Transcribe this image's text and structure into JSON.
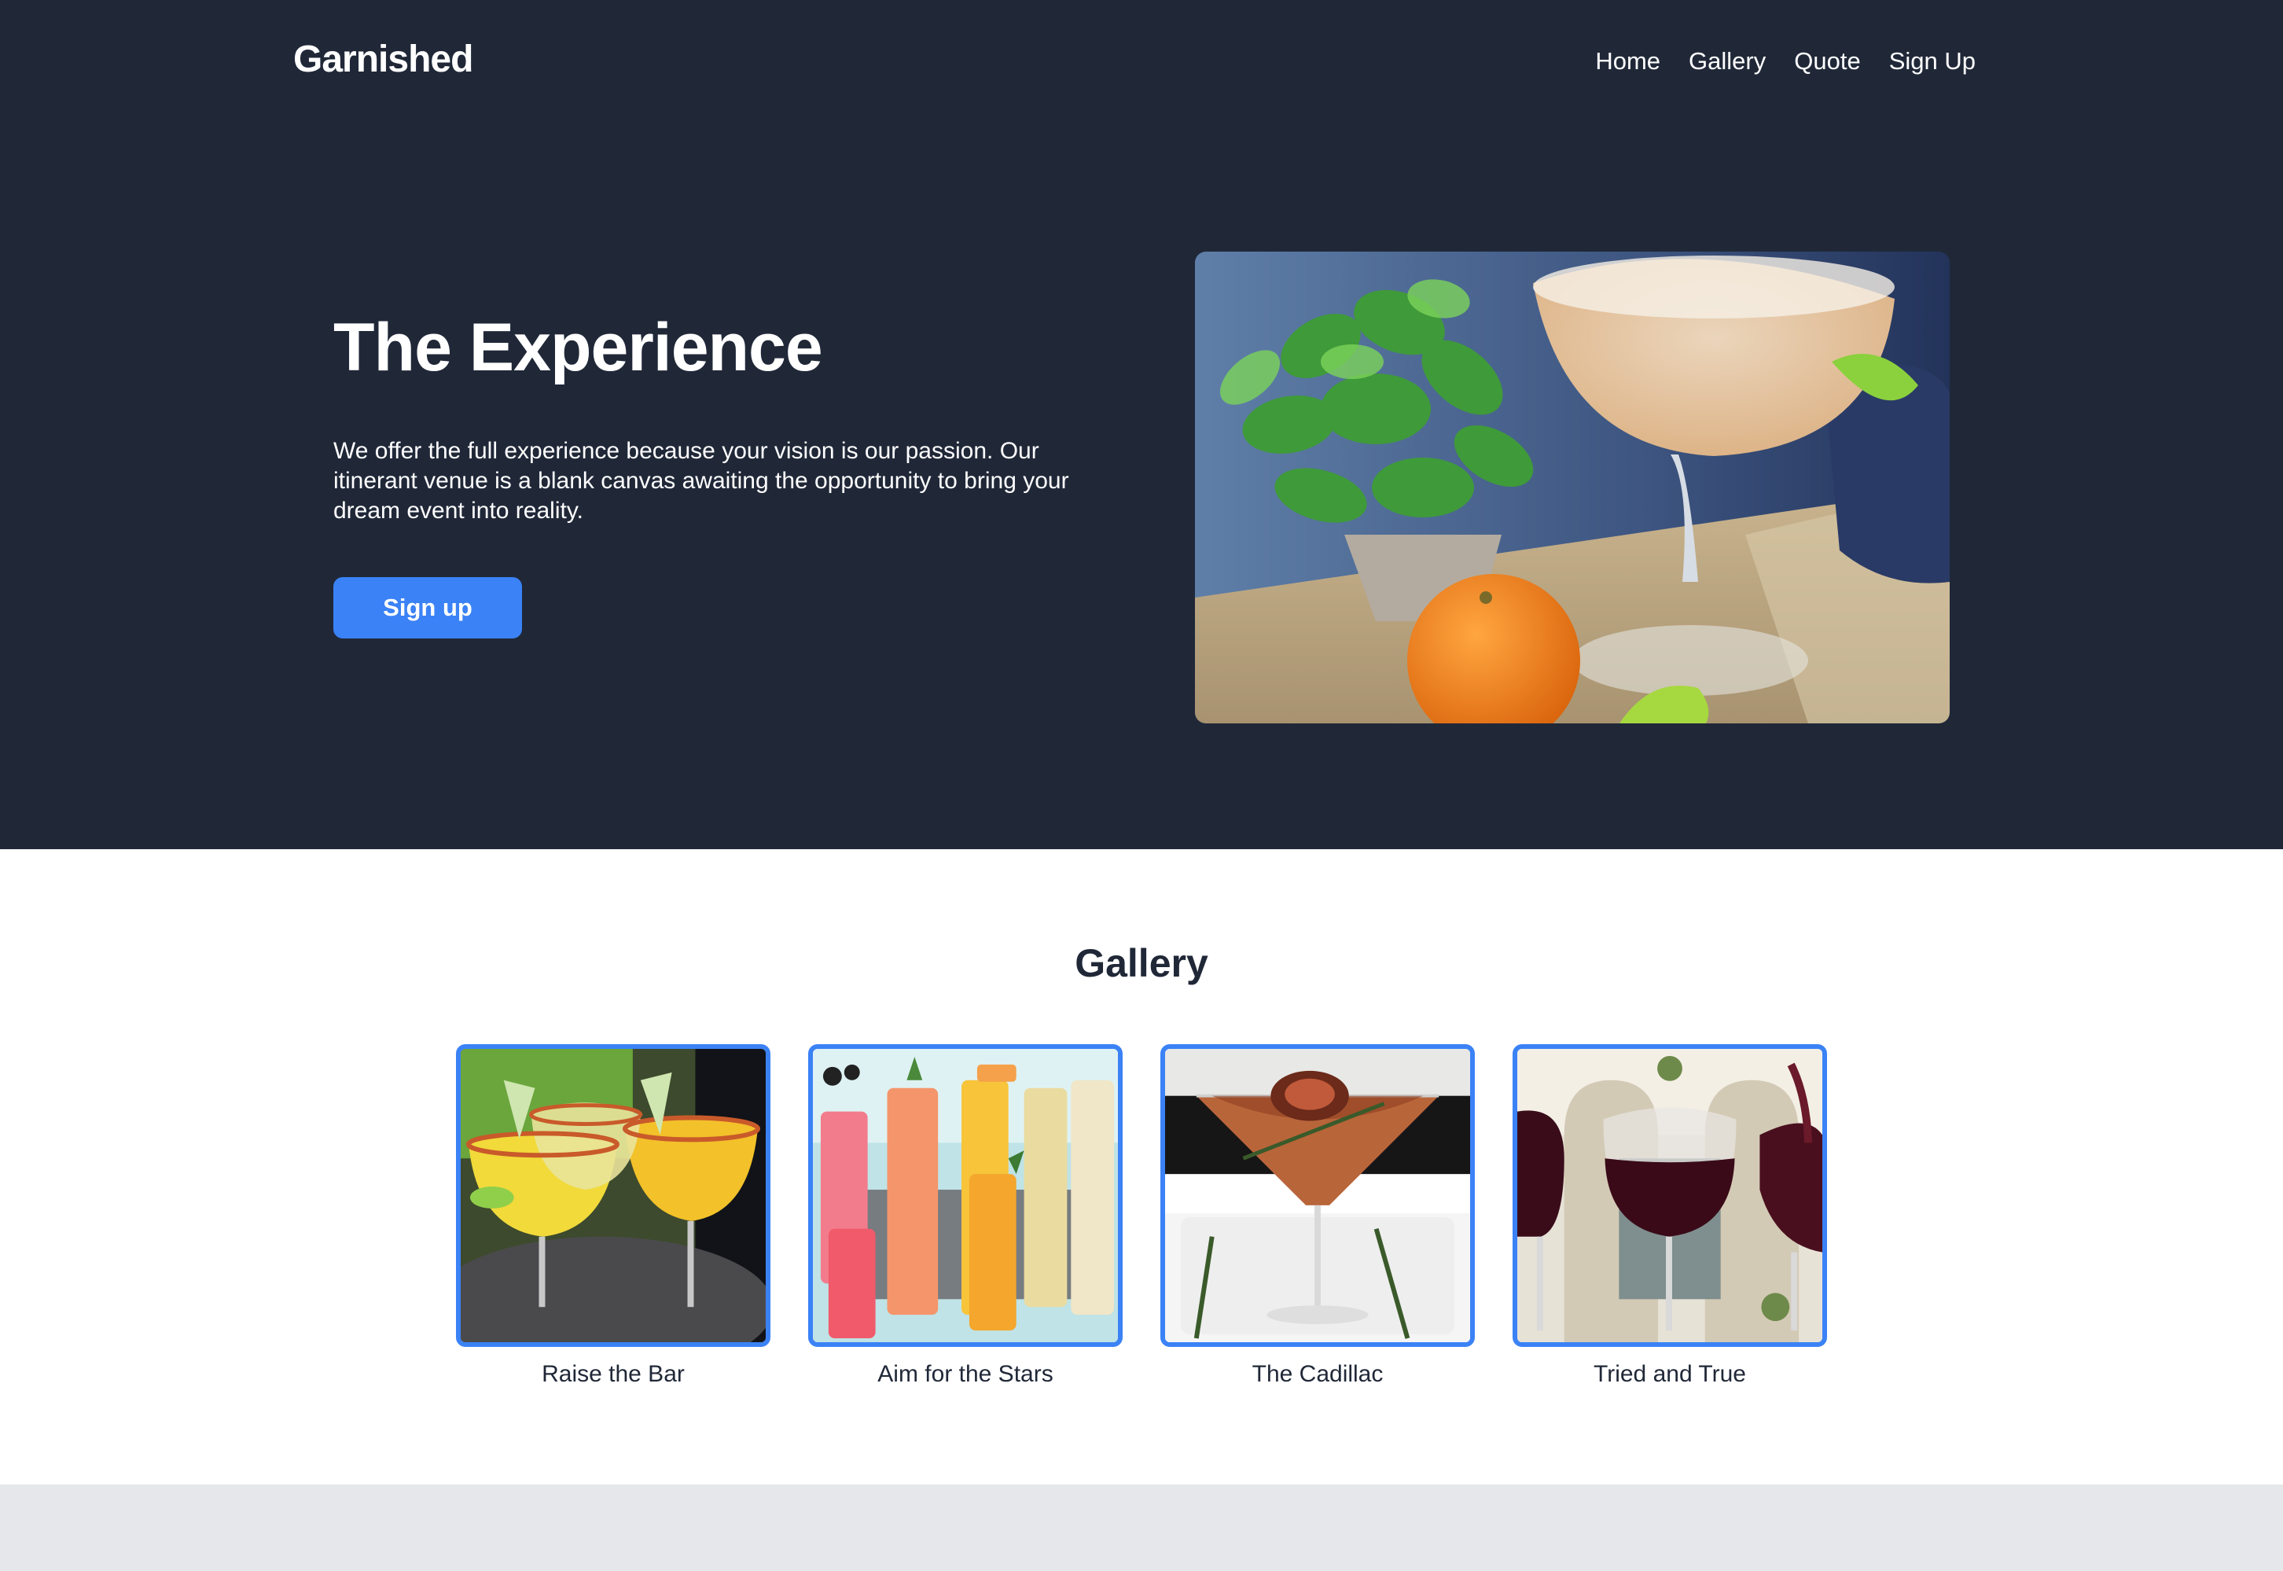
{
  "header": {
    "brand": "Garnished",
    "nav": [
      "Home",
      "Gallery",
      "Quote",
      "Sign Up"
    ]
  },
  "hero": {
    "title": "The Experience",
    "text": "We offer the full experience because your vision is our passion. Our itinerant venue is a blank canvas awaiting the opportunity to bring your dream event into reality.",
    "button": "Sign up",
    "image_icon": "margarita-photo"
  },
  "gallery": {
    "title": "Gallery",
    "items": [
      {
        "label": "Raise the Bar",
        "image_icon": "margarita-glasses-photo"
      },
      {
        "label": "Aim for the Stars",
        "image_icon": "colorful-cocktails-photo"
      },
      {
        "label": "The Cadillac",
        "image_icon": "martini-fig-photo"
      },
      {
        "label": "Tried and True",
        "image_icon": "red-wine-glasses-photo"
      }
    ]
  },
  "colors": {
    "hero_bg": "#202838",
    "accent": "#3b82f6",
    "footer_bg": "#e5e7eb"
  }
}
